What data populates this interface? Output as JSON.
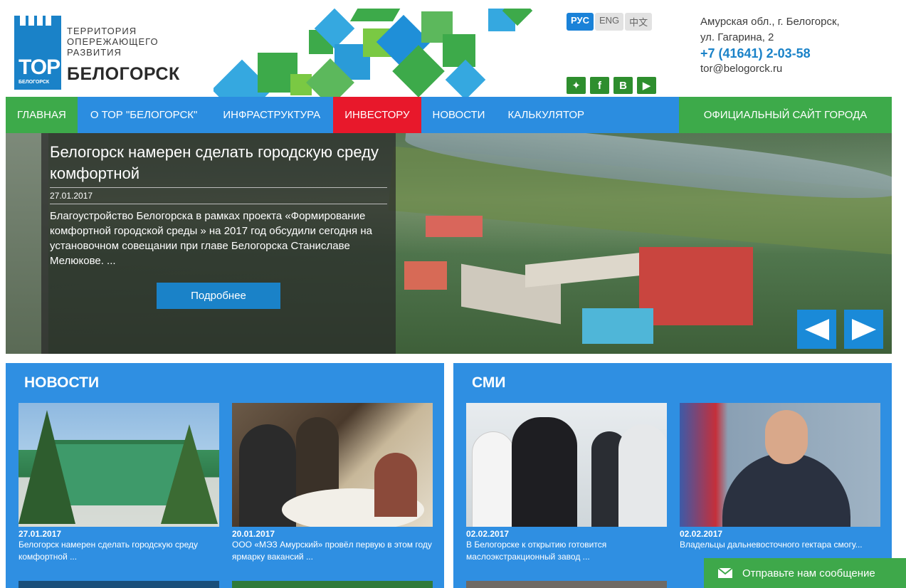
{
  "logo": {
    "bars_text": "TOP",
    "sub": "БЕЛОГОРСК",
    "line1": "ТЕРРИТОРИЯ",
    "line2": "ОПЕРЕЖАЮЩЕГО",
    "line3": "РАЗВИТИЯ",
    "city": "БЕЛОГОРСК"
  },
  "languages": [
    "РУС",
    "ENG",
    "中文"
  ],
  "active_language": "РУС",
  "social": [
    "evernote-icon",
    "facebook-icon",
    "vk-icon",
    "youtube-icon"
  ],
  "contacts": {
    "address1": "Амурская обл., г. Белогорск,",
    "address2": "ул. Гагарина, 2",
    "phone": "+7 (41641) 2-03-58",
    "email": "tor@belogorck.ru"
  },
  "nav": {
    "items": [
      {
        "label": "ГЛАВНАЯ",
        "style": "green"
      },
      {
        "label": "О ТОР \"БЕЛОГОРСК\"",
        "style": "blue"
      },
      {
        "label": "ИНФРАСТРУКТУРА",
        "style": "blue"
      },
      {
        "label": "ИНВЕСТОРУ",
        "style": "red"
      },
      {
        "label": "НОВОСТИ",
        "style": "blue"
      },
      {
        "label": "КАЛЬКУЛЯТОР",
        "style": "blue"
      }
    ],
    "city_site": "ОФИЦИАЛЬНЫЙ САЙТ ГОРОДА"
  },
  "slider": {
    "title": "Белогорск намерен сделать городскую среду комфортной",
    "date": "27.01.2017",
    "text": "Благоустройство Белогорска в рамках проекта «Формирование комфортной городской среды » на 2017 год обсудили сегодня на установочном совещании при главе Белогорска Станиславе Мелюкове. ...",
    "button": "Подробнее"
  },
  "news": {
    "title": "НОВОСТИ",
    "items": [
      {
        "date": "27.01.2017",
        "text": "Белогорск намерен сделать городскую среду комфортной ..."
      },
      {
        "date": "20.01.2017",
        "text": "ООО «МЭЗ Амурский» провёл первую в этом году ярмарку вакансий ..."
      }
    ]
  },
  "smi": {
    "title": "СМИ",
    "items": [
      {
        "date": "02.02.2017",
        "text": "В Белогорске к открытию готовится маслоэкстракционный завод ..."
      },
      {
        "date": "02.02.2017",
        "text": "Владельцы дальневосточного гектара смогу..."
      }
    ]
  },
  "message_bar": "Отправьте нам сообщение",
  "colors": {
    "blue": "#2b8de0",
    "green": "#3daa4a",
    "red": "#e8182b",
    "dark_blue": "#1a82c8"
  }
}
